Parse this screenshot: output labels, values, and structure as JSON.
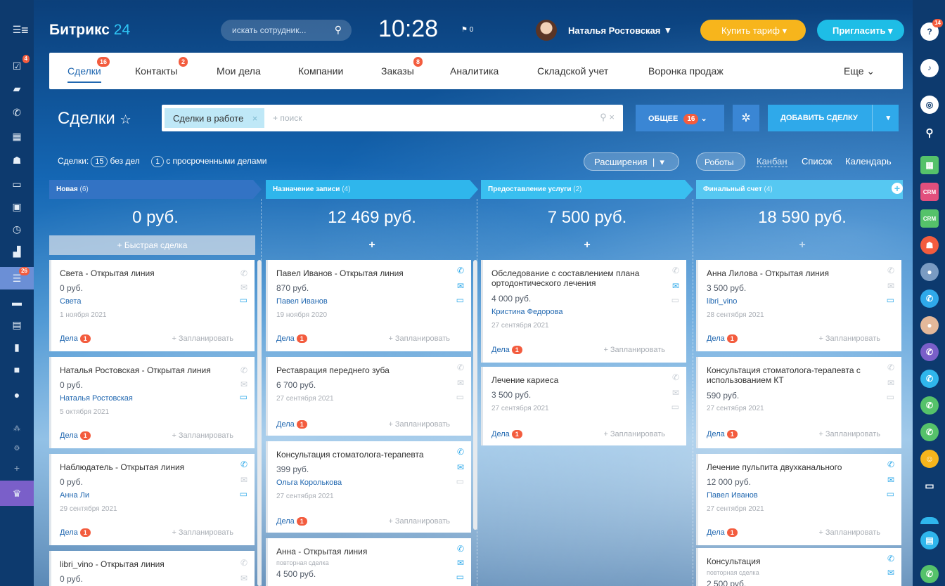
{
  "header": {
    "logo_main": "Битрикс",
    "logo_num": "24",
    "search_placeholder": "искать сотрудник...",
    "clock": "10:28",
    "flag_count": "0",
    "user_name": "Наталья Ростовская",
    "buy_label": "Купить тариф",
    "invite_label": "Пригласить"
  },
  "left_badges": {
    "tasks": "4",
    "crm": "26"
  },
  "right_badges": {
    "help": "14"
  },
  "tabs": [
    {
      "label": "Сделки",
      "badge": "16"
    },
    {
      "label": "Контакты",
      "badge": "2"
    },
    {
      "label": "Мои дела",
      "badge": ""
    },
    {
      "label": "Компании",
      "badge": ""
    },
    {
      "label": "Заказы",
      "badge": "8"
    },
    {
      "label": "Аналитика",
      "badge": ""
    },
    {
      "label": "Складской учет",
      "badge": ""
    },
    {
      "label": "Воронка продаж",
      "badge": ""
    },
    {
      "label": "Еще",
      "badge": ""
    }
  ],
  "toolbar": {
    "title": "Сделки",
    "filter_chip": "Сделки в работе",
    "filter_placeholder": "+ поиск",
    "common_label": "ОБЩЕЕ",
    "common_count": "16",
    "add_label": "ДОБАВИТЬ СДЕЛКУ"
  },
  "stats": {
    "label": "Сделки:",
    "no_tasks_count": "15",
    "no_tasks_label": "без дел",
    "overdue_count": "1",
    "overdue_label": "с просроченными делами"
  },
  "view": {
    "extensions": "Расширения",
    "robots": "Роботы",
    "kanban": "Канбан",
    "list": "Список",
    "calendar": "Календарь"
  },
  "colors": {
    "accent": "#2067b0",
    "badge": "#f35c3e",
    "stage1": "#3373c4",
    "stage2": "#2fb6ec",
    "stage3": "#39bff0",
    "stage4": "#56c8f2"
  },
  "columns": [
    {
      "name": "Новая",
      "count": "(6)",
      "sum": "0 руб.",
      "quick": "+ Быстрая сделка"
    },
    {
      "name": "Назначение записи",
      "count": "(4)",
      "sum": "12 469 руб."
    },
    {
      "name": "Предоставление услуги",
      "count": "(2)",
      "sum": "7 500 руб."
    },
    {
      "name": "Финальный счет",
      "count": "(4)",
      "sum": "18 590 руб."
    }
  ],
  "cards": {
    "c1": {
      "title": "Света - Открытая линия",
      "price": "0 руб.",
      "contact": "Света",
      "date": "1 ноября 2021"
    },
    "c2": {
      "title": "Наталья Ростовская - Открытая линия",
      "price": "0 руб.",
      "contact": "Наталья Ростовская",
      "date": "5 октября 2021"
    },
    "c3": {
      "title": "Наблюдатель - Открытая линия",
      "price": "0 руб.",
      "contact": "Анна Ли",
      "date": "29 сентября 2021"
    },
    "c4": {
      "title": "libri_vino - Открытая линия",
      "price": "0 руб."
    },
    "c5": {
      "title": "Павел Иванов - Открытая линия",
      "price": "870 руб.",
      "contact": "Павел Иванов",
      "date": "19 ноября 2020"
    },
    "c6": {
      "title": "Реставрация переднего зуба",
      "price": "6 700 руб.",
      "date": "27 сентября 2021"
    },
    "c7": {
      "title": "Консультация стоматолога-терапевта",
      "price": "399 руб.",
      "contact": "Ольга Королькова",
      "date": "27 сентября 2021"
    },
    "c8": {
      "title": "Анна - Открытая линия",
      "sub": "повторная сделка",
      "price": "4 500 руб."
    },
    "c9": {
      "title": "Обследование с составлением плана ортодонтического лечения",
      "price": "4 000 руб.",
      "contact": "Кристина Федорова",
      "date": "27 сентября 2021"
    },
    "c10": {
      "title": "Лечение кариеса",
      "price": "3 500 руб.",
      "date": "27 сентября 2021"
    },
    "c11": {
      "title": "Анна Лилова - Открытая линия",
      "price": "3 500 руб.",
      "contact": "libri_vino",
      "date": "28 сентября 2021"
    },
    "c12": {
      "title": "Консультация стоматолога-терапевта с использованием КТ",
      "price": "590 руб.",
      "date": "27 сентября 2021"
    },
    "c13": {
      "title": "Лечение пульпита двухканального",
      "price": "12 000 руб.",
      "contact": "Павел Иванов",
      "date": "27 сентября 2021"
    },
    "c14": {
      "title": "Консультация",
      "sub": "повторная сделка",
      "price": "2 500 руб."
    }
  },
  "card_common": {
    "dela": "Дела",
    "dela_badge": "1",
    "plan": "+ Запланировать"
  }
}
